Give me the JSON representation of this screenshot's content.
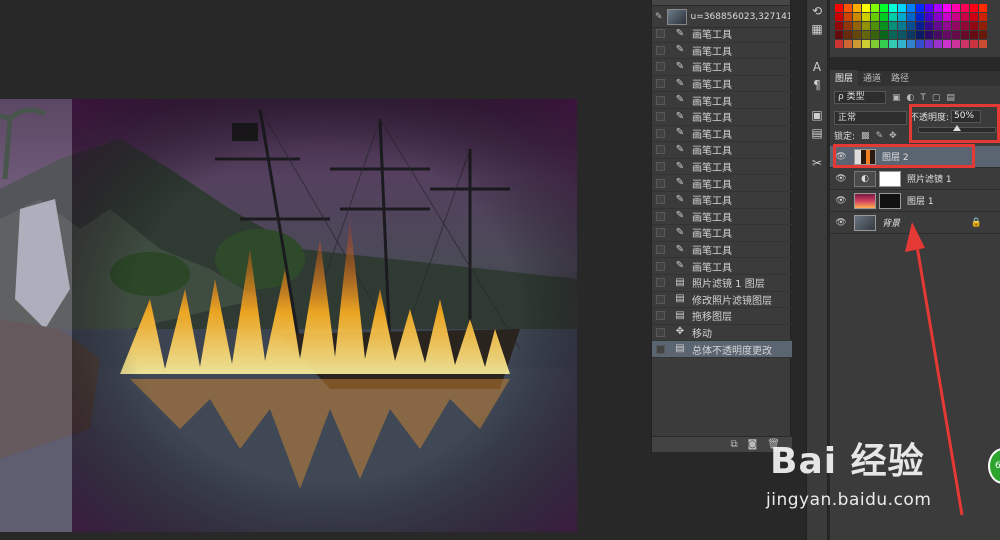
{
  "history": {
    "snapshot_label": "u=368856023,327141...",
    "items": [
      {
        "label": "画笔工具",
        "icon": "brush-icon"
      },
      {
        "label": "画笔工具",
        "icon": "brush-icon"
      },
      {
        "label": "画笔工具",
        "icon": "brush-icon"
      },
      {
        "label": "画笔工具",
        "icon": "brush-icon"
      },
      {
        "label": "画笔工具",
        "icon": "brush-icon"
      },
      {
        "label": "画笔工具",
        "icon": "brush-icon"
      },
      {
        "label": "画笔工具",
        "icon": "brush-icon"
      },
      {
        "label": "画笔工具",
        "icon": "brush-icon"
      },
      {
        "label": "画笔工具",
        "icon": "brush-icon"
      },
      {
        "label": "画笔工具",
        "icon": "brush-icon"
      },
      {
        "label": "画笔工具",
        "icon": "brush-icon"
      },
      {
        "label": "画笔工具",
        "icon": "brush-icon"
      },
      {
        "label": "画笔工具",
        "icon": "brush-icon"
      },
      {
        "label": "画笔工具",
        "icon": "brush-icon"
      },
      {
        "label": "画笔工具",
        "icon": "brush-icon"
      },
      {
        "label": "照片滤镜 1 图层",
        "icon": "layer-doc-icon"
      },
      {
        "label": "修改照片滤镜图层",
        "icon": "layer-doc-icon"
      },
      {
        "label": "拖移图层",
        "icon": "layer-doc-icon"
      },
      {
        "label": "移动",
        "icon": "move-icon"
      },
      {
        "label": "总体不透明度更改",
        "icon": "layer-doc-icon"
      }
    ]
  },
  "layers": {
    "tabs": [
      "图层",
      "通道",
      "路径"
    ],
    "filter_label": "ρ 类型",
    "blend_mode": "正常",
    "opacity_label": "不透明度:",
    "opacity_value": "50%",
    "opacity_fraction": 0.5,
    "lock_label": "锁定:",
    "list": [
      {
        "name": "图层 2",
        "selected": true
      },
      {
        "name": "照片滤镜 1",
        "selected": false
      },
      {
        "name": "图层 1",
        "selected": false
      },
      {
        "name": "背景",
        "selected": false
      }
    ]
  },
  "watermark": {
    "brand": "Bai 经验",
    "url": "jingyan.baidu.com",
    "badge": "6"
  },
  "colors": {
    "annotation": "#e53935",
    "selection": "#5b6572",
    "panel": "#3b3b3b"
  }
}
